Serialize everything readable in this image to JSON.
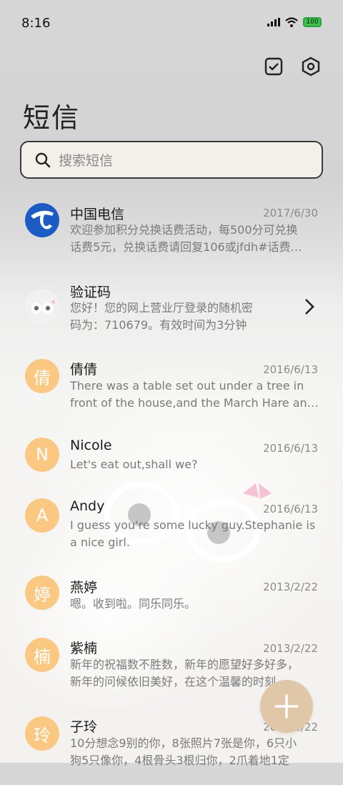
{
  "status_bar": {
    "time": "8:16",
    "battery": "100"
  },
  "header": {
    "title": "短信"
  },
  "search": {
    "placeholder": "搜索短信"
  },
  "messages": [
    {
      "name": "中国电信",
      "date": "2017/6/30",
      "line1": "欢迎参加积分兑换话费活动，每500分可兑换",
      "line2": "话费5元，兑换话费请回复106或jfdh#话费…",
      "avatar": "telecom-logo"
    },
    {
      "name": "验证码",
      "date": "",
      "line1": "您好！您的网上营业厅登录的随机密",
      "line2": "码为：710679。有效时间为3分钟",
      "avatar": "cat-photo"
    },
    {
      "name": "倩倩",
      "date": "2016/6/13",
      "line1": "There was a table set out under a tree in",
      "line2": "front of the house,and the March Hare an…",
      "avatar": "倩"
    },
    {
      "name": "Nicole",
      "date": "2016/6/13",
      "line1": "Let's eat out,shall we?",
      "line2": "",
      "avatar": "N"
    },
    {
      "name": "Andy",
      "date": "2016/6/13",
      "line1": "I guess you're some lucky guy.Stephanie is",
      "line2": "a nice girl.",
      "avatar": "A"
    },
    {
      "name": "燕婷",
      "date": "2013/2/22",
      "line1": "嗯。收到啦。同乐同乐。",
      "line2": "",
      "avatar": "婷"
    },
    {
      "name": "紫楠",
      "date": "2013/2/22",
      "line1": "新年的祝福数不胜数，新年的愿望好多好多，",
      "line2": "新年的问候依旧美好，在这个温馨的时刻…",
      "avatar": "楠"
    },
    {
      "name": "子玲",
      "date": "2013/2/22",
      "line1": "10分想念9别的你，8张照片7张是你，6只小",
      "line2": "狗5只像你，4根骨头3根归你，2爪着地1定",
      "avatar": "玲"
    }
  ],
  "colors": {
    "avatar_bg": "#fbc882",
    "fab_bg": "#e0c7a8",
    "search_bg": "#f3efe9"
  },
  "icons": {
    "select": "checkbox-icon",
    "settings": "settings-hex-icon",
    "compose": "plus-icon"
  }
}
